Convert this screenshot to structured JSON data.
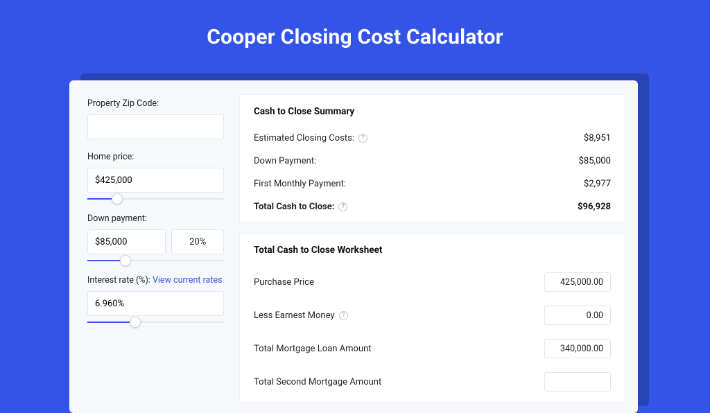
{
  "title": "Cooper Closing Cost Calculator",
  "colors": {
    "brand": "#3354e6"
  },
  "sidebar": {
    "zip": {
      "label": "Property Zip Code:",
      "value": ""
    },
    "price": {
      "label": "Home price:",
      "value": "$425,000",
      "slider_pct": 22
    },
    "down": {
      "label": "Down payment:",
      "value": "$85,000",
      "pct": "20%",
      "slider_pct": 28
    },
    "rate": {
      "label": "Interest rate (%): ",
      "link": "View current rates",
      "value": "6.960%",
      "slider_pct": 35
    }
  },
  "summary": {
    "title": "Cash to Close Summary",
    "rows": [
      {
        "label": "Estimated Closing Costs:",
        "help": true,
        "value": "$8,951"
      },
      {
        "label": "Down Payment:",
        "help": false,
        "value": "$85,000"
      },
      {
        "label": "First Monthly Payment:",
        "help": false,
        "value": "$2,977"
      }
    ],
    "total": {
      "label": "Total Cash to Close:",
      "help": true,
      "value": "$96,928"
    }
  },
  "worksheet": {
    "title": "Total Cash to Close Worksheet",
    "rows": [
      {
        "label": "Purchase Price",
        "help": false,
        "value": "425,000.00"
      },
      {
        "label": "Less Earnest Money",
        "help": true,
        "value": "0.00"
      },
      {
        "label": "Total Mortgage Loan Amount",
        "help": false,
        "value": "340,000.00"
      },
      {
        "label": "Total Second Mortgage Amount",
        "help": false,
        "value": ""
      }
    ]
  }
}
